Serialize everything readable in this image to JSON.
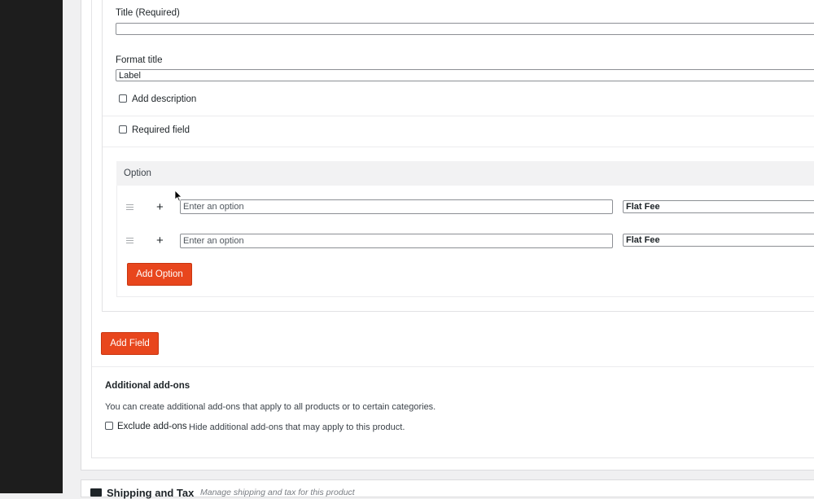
{
  "field": {
    "title_label": "Title (Required)",
    "title_value": "",
    "format_label": "Format title",
    "format_value": "Label",
    "add_description": "Add description",
    "required_field": "Required field"
  },
  "options": {
    "header": "Option",
    "rows": [
      {
        "placeholder": "Enter an option",
        "fee": "Flat Fee"
      },
      {
        "placeholder": "Enter an option",
        "fee": "Flat Fee"
      }
    ],
    "add_option": "Add Option"
  },
  "add_field": "Add Field",
  "additional": {
    "title": "Additional add-ons",
    "desc": "You can create additional add-ons that apply to all products or to certain categories.",
    "exclude_label": "Exclude add-ons",
    "exclude_desc": "Hide additional add-ons that may apply to this product."
  },
  "shipping": {
    "title": "Shipping and Tax",
    "subtitle": "Manage shipping and tax for this product"
  },
  "colors": {
    "accent": "#e8461d",
    "sidebar": "#1d1d1d"
  }
}
